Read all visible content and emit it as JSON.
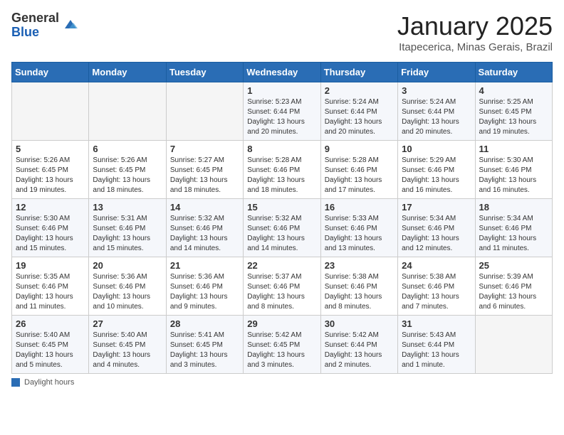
{
  "header": {
    "logo_general": "General",
    "logo_blue": "Blue",
    "month_title": "January 2025",
    "subtitle": "Itapecerica, Minas Gerais, Brazil"
  },
  "weekdays": [
    "Sunday",
    "Monday",
    "Tuesday",
    "Wednesday",
    "Thursday",
    "Friday",
    "Saturday"
  ],
  "weeks": [
    [
      {
        "day": "",
        "info": ""
      },
      {
        "day": "",
        "info": ""
      },
      {
        "day": "",
        "info": ""
      },
      {
        "day": "1",
        "info": "Sunrise: 5:23 AM\nSunset: 6:44 PM\nDaylight: 13 hours\nand 20 minutes."
      },
      {
        "day": "2",
        "info": "Sunrise: 5:24 AM\nSunset: 6:44 PM\nDaylight: 13 hours\nand 20 minutes."
      },
      {
        "day": "3",
        "info": "Sunrise: 5:24 AM\nSunset: 6:44 PM\nDaylight: 13 hours\nand 20 minutes."
      },
      {
        "day": "4",
        "info": "Sunrise: 5:25 AM\nSunset: 6:45 PM\nDaylight: 13 hours\nand 19 minutes."
      }
    ],
    [
      {
        "day": "5",
        "info": "Sunrise: 5:26 AM\nSunset: 6:45 PM\nDaylight: 13 hours\nand 19 minutes."
      },
      {
        "day": "6",
        "info": "Sunrise: 5:26 AM\nSunset: 6:45 PM\nDaylight: 13 hours\nand 18 minutes."
      },
      {
        "day": "7",
        "info": "Sunrise: 5:27 AM\nSunset: 6:45 PM\nDaylight: 13 hours\nand 18 minutes."
      },
      {
        "day": "8",
        "info": "Sunrise: 5:28 AM\nSunset: 6:46 PM\nDaylight: 13 hours\nand 18 minutes."
      },
      {
        "day": "9",
        "info": "Sunrise: 5:28 AM\nSunset: 6:46 PM\nDaylight: 13 hours\nand 17 minutes."
      },
      {
        "day": "10",
        "info": "Sunrise: 5:29 AM\nSunset: 6:46 PM\nDaylight: 13 hours\nand 16 minutes."
      },
      {
        "day": "11",
        "info": "Sunrise: 5:30 AM\nSunset: 6:46 PM\nDaylight: 13 hours\nand 16 minutes."
      }
    ],
    [
      {
        "day": "12",
        "info": "Sunrise: 5:30 AM\nSunset: 6:46 PM\nDaylight: 13 hours\nand 15 minutes."
      },
      {
        "day": "13",
        "info": "Sunrise: 5:31 AM\nSunset: 6:46 PM\nDaylight: 13 hours\nand 15 minutes."
      },
      {
        "day": "14",
        "info": "Sunrise: 5:32 AM\nSunset: 6:46 PM\nDaylight: 13 hours\nand 14 minutes."
      },
      {
        "day": "15",
        "info": "Sunrise: 5:32 AM\nSunset: 6:46 PM\nDaylight: 13 hours\nand 14 minutes."
      },
      {
        "day": "16",
        "info": "Sunrise: 5:33 AM\nSunset: 6:46 PM\nDaylight: 13 hours\nand 13 minutes."
      },
      {
        "day": "17",
        "info": "Sunrise: 5:34 AM\nSunset: 6:46 PM\nDaylight: 13 hours\nand 12 minutes."
      },
      {
        "day": "18",
        "info": "Sunrise: 5:34 AM\nSunset: 6:46 PM\nDaylight: 13 hours\nand 11 minutes."
      }
    ],
    [
      {
        "day": "19",
        "info": "Sunrise: 5:35 AM\nSunset: 6:46 PM\nDaylight: 13 hours\nand 11 minutes."
      },
      {
        "day": "20",
        "info": "Sunrise: 5:36 AM\nSunset: 6:46 PM\nDaylight: 13 hours\nand 10 minutes."
      },
      {
        "day": "21",
        "info": "Sunrise: 5:36 AM\nSunset: 6:46 PM\nDaylight: 13 hours\nand 9 minutes."
      },
      {
        "day": "22",
        "info": "Sunrise: 5:37 AM\nSunset: 6:46 PM\nDaylight: 13 hours\nand 8 minutes."
      },
      {
        "day": "23",
        "info": "Sunrise: 5:38 AM\nSunset: 6:46 PM\nDaylight: 13 hours\nand 8 minutes."
      },
      {
        "day": "24",
        "info": "Sunrise: 5:38 AM\nSunset: 6:46 PM\nDaylight: 13 hours\nand 7 minutes."
      },
      {
        "day": "25",
        "info": "Sunrise: 5:39 AM\nSunset: 6:46 PM\nDaylight: 13 hours\nand 6 minutes."
      }
    ],
    [
      {
        "day": "26",
        "info": "Sunrise: 5:40 AM\nSunset: 6:45 PM\nDaylight: 13 hours\nand 5 minutes."
      },
      {
        "day": "27",
        "info": "Sunrise: 5:40 AM\nSunset: 6:45 PM\nDaylight: 13 hours\nand 4 minutes."
      },
      {
        "day": "28",
        "info": "Sunrise: 5:41 AM\nSunset: 6:45 PM\nDaylight: 13 hours\nand 3 minutes."
      },
      {
        "day": "29",
        "info": "Sunrise: 5:42 AM\nSunset: 6:45 PM\nDaylight: 13 hours\nand 3 minutes."
      },
      {
        "day": "30",
        "info": "Sunrise: 5:42 AM\nSunset: 6:44 PM\nDaylight: 13 hours\nand 2 minutes."
      },
      {
        "day": "31",
        "info": "Sunrise: 5:43 AM\nSunset: 6:44 PM\nDaylight: 13 hours\nand 1 minute."
      },
      {
        "day": "",
        "info": ""
      }
    ]
  ],
  "footer": {
    "note": "Daylight hours"
  }
}
